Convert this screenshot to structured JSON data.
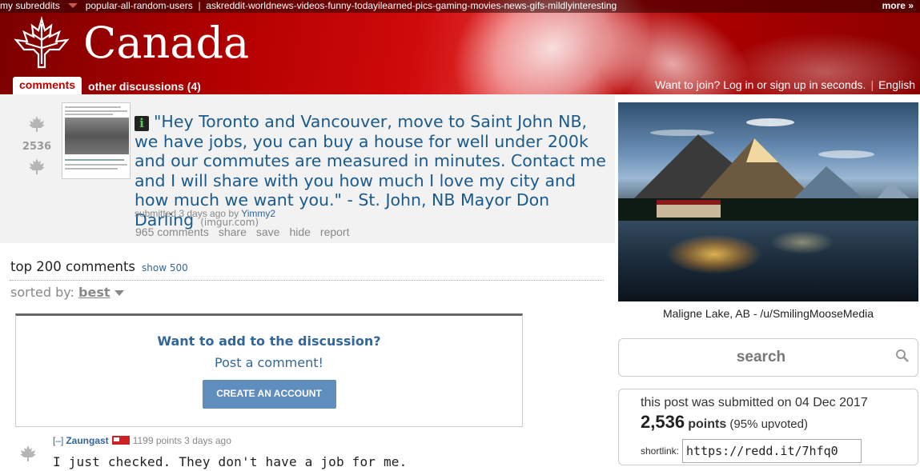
{
  "top_bar": {
    "my_subreddits": "my subreddits",
    "links": [
      "popular",
      "all",
      "random",
      "users"
    ],
    "subs": [
      "askreddit",
      "worldnews",
      "videos",
      "funny",
      "todayilearned",
      "pics",
      "gaming",
      "movies",
      "news",
      "gifs",
      "mildlyinteresting"
    ],
    "more": "more »"
  },
  "header": {
    "subreddit_name": "Canada",
    "tabs": [
      {
        "label": "comments"
      },
      {
        "label": "other discussions (4)"
      }
    ],
    "join_text": "Want to join? Log in or sign up in seconds.",
    "language": "English"
  },
  "post": {
    "score": "2536",
    "title": "\"Hey Toronto and Vancouver, move to Saint John NB, we have jobs, you can buy a house for well under 200k and our commutes are measured in minutes. Contact me and I will share with you how much I love my city and how much we want you.\" - St. John, NB Mayor Don Darling",
    "domain": "(imgur.com)",
    "submitted_prefix": "submitted 3 days ago by",
    "author": "Yimmy2",
    "buttons": [
      "965 comments",
      "share",
      "save",
      "hide",
      "report"
    ]
  },
  "comments": {
    "title": "top 200 comments",
    "show_more": "show 500",
    "sorted_by_label": "sorted by:",
    "sort_value": "best",
    "join_prompt": {
      "question": "Want to add to the discussion?",
      "cta": "Post a comment!",
      "button": "CREATE AN ACCOUNT"
    },
    "first_comment": {
      "toggle": "[–]",
      "author": "Zaungast",
      "meta": "1199 points 3 days ago",
      "body": "I just checked. They don't have a job for me."
    }
  },
  "sidebar": {
    "image_caption": "Maligne Lake, AB - /u/SmilingMooseMedia",
    "search_placeholder": "search",
    "submitted_on": "this post was submitted on 04 Dec 2017",
    "points_number": "2,536",
    "points_label": "points",
    "upvoted": "(95% upvoted)",
    "shortlink_label": "shortlink:",
    "shortlink_value": "https://redd.it/7hfq0"
  },
  "colors": {
    "header_red": "#c00000",
    "link_blue": "#336699",
    "title_blue": "#1a5a8c",
    "button_blue": "#5f8dbd"
  }
}
